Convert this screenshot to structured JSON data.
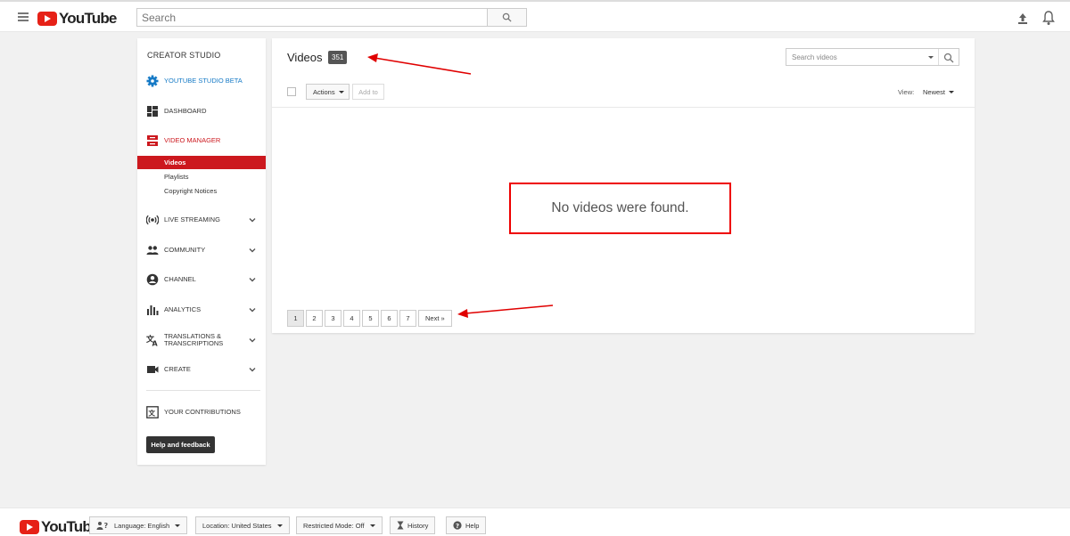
{
  "header": {
    "logo_text": "YouTube",
    "search_placeholder": "Search"
  },
  "sidebar": {
    "title": "CREATOR STUDIO",
    "items": [
      {
        "label": "YOUTUBE STUDIO BETA",
        "color": "#167ac6"
      },
      {
        "label": "DASHBOARD"
      },
      {
        "label": "VIDEO MANAGER",
        "color": "#cc181e"
      },
      {
        "label": "LIVE STREAMING"
      },
      {
        "label": "COMMUNITY"
      },
      {
        "label": "CHANNEL"
      },
      {
        "label": "ANALYTICS"
      },
      {
        "label": "TRANSLATIONS & TRANSCRIPTIONS"
      },
      {
        "label": "CREATE"
      },
      {
        "label": "YOUR CONTRIBUTIONS"
      }
    ],
    "sub_items": [
      "Videos",
      "Playlists",
      "Copyright Notices"
    ],
    "help_button": "Help and feedback"
  },
  "main": {
    "title": "Videos",
    "count": "351",
    "search_placeholder": "Search videos",
    "actions_label": "Actions",
    "add_to_label": "Add to",
    "view_label": "View:",
    "view_value": "Newest",
    "empty_message": "No videos were found.",
    "pages": [
      "1",
      "2",
      "3",
      "4",
      "5",
      "6",
      "7"
    ],
    "next_label": "Next »",
    "active_page": "1"
  },
  "footer": {
    "logo_text": "YouTube",
    "language": "Language: English",
    "location": "Location: United States",
    "restricted": "Restricted Mode: Off",
    "history": "History",
    "help": "Help"
  },
  "colors": {
    "brand_red": "#e62117",
    "annotation_red": "#e00000",
    "accent_blue": "#167ac6"
  }
}
